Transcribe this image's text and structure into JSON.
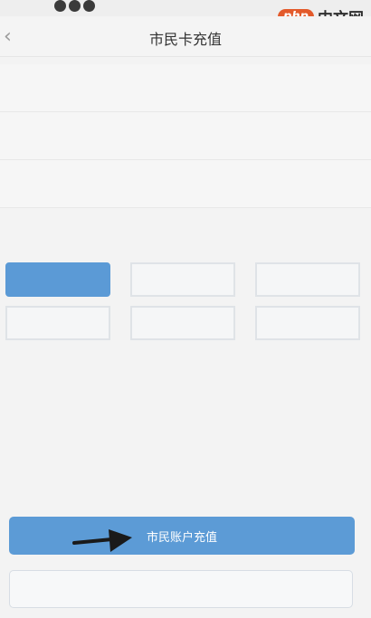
{
  "watermark": {
    "logo": "php",
    "text": "中文网"
  },
  "navbar": {
    "back_icon": "chevron-left-icon",
    "title": "市民卡充值"
  },
  "info_rows": [
    {
      "label": "",
      "value": ""
    },
    {
      "label": "",
      "value": ""
    },
    {
      "label": "",
      "value": ""
    }
  ],
  "recharge": {
    "section_title": "",
    "amounts": [
      {
        "label": "",
        "selected": true
      },
      {
        "label": "",
        "selected": false
      },
      {
        "label": "",
        "selected": false
      },
      {
        "label": "",
        "selected": false
      },
      {
        "label": "",
        "selected": false
      },
      {
        "label": "",
        "selected": false
      }
    ],
    "custom_label": "",
    "custom_value": ""
  },
  "notes": {
    "title": "",
    "items": [
      "",
      "",
      ""
    ]
  },
  "buttons": {
    "primary": "市民账户充值",
    "secondary": ""
  },
  "colors": {
    "primary": "#5c9bd6",
    "note_red": "#eaa0a0",
    "arrow": "#1a1a1a"
  }
}
